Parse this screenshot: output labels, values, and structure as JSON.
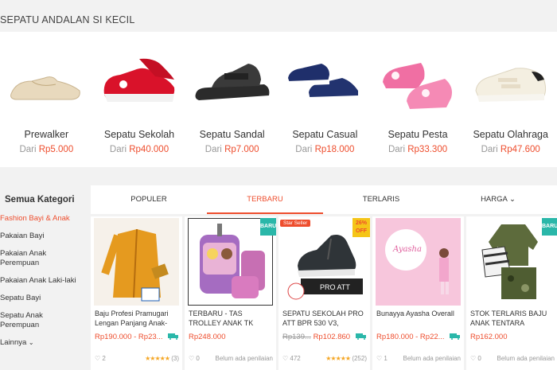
{
  "section": {
    "title": "SEPATU ANDALAN SI KECIL"
  },
  "categories": [
    {
      "name": "Prewalker",
      "price_prefix": "Dari",
      "price": "Rp5.000"
    },
    {
      "name": "Sepatu Sekolah",
      "price_prefix": "Dari",
      "price": "Rp40.000"
    },
    {
      "name": "Sepatu Sandal",
      "price_prefix": "Dari",
      "price": "Rp7.000"
    },
    {
      "name": "Sepatu Casual",
      "price_prefix": "Dari",
      "price": "Rp18.000"
    },
    {
      "name": "Sepatu Pesta",
      "price_prefix": "Dari",
      "price": "Rp33.300"
    },
    {
      "name": "Sepatu Olahraga",
      "price_prefix": "Dari",
      "price": "Rp47.600"
    }
  ],
  "sidebar": {
    "heading": "Semua Kategori",
    "items": [
      {
        "label": "Fashion Bayi & Anak"
      },
      {
        "label": "Pakaian Bayi"
      },
      {
        "label": "Pakaian Anak Perempuan"
      },
      {
        "label": "Pakaian Anak Laki-laki"
      },
      {
        "label": "Sepatu Bayi"
      },
      {
        "label": "Sepatu Anak Perempuan"
      },
      {
        "label": "Lainnya"
      }
    ]
  },
  "tabs": [
    {
      "label": "POPULER"
    },
    {
      "label": "TERBARU"
    },
    {
      "label": "TERLARIS"
    },
    {
      "label": "HARGA"
    }
  ],
  "products": [
    {
      "title": "Baju Profesi Pramugari Lengan Panjang Anak-",
      "price": "Rp190.000 - Rp23...",
      "likes": "2",
      "rating_text": "(3)"
    },
    {
      "title": "TERBARU - TAS TROLLEY ANAK TK",
      "price": "Rp248.000",
      "likes": "0",
      "rating_text": "Belum ada penilaian",
      "badge": "BARU"
    },
    {
      "title": "SEPATU SEKOLAH PRO ATT BPR 530 V3,",
      "price_old": "Rp139...",
      "price": "Rp102.860",
      "likes": "472",
      "rating_text": "(252)",
      "seller": "Star Seller",
      "discount": "26%",
      "discount_label": "OFF"
    },
    {
      "title": "Bunayya Ayasha Overall",
      "price": "Rp180.000 - Rp22...",
      "likes": "1",
      "rating_text": "Belum ada penilaian"
    },
    {
      "title": "STOK TERLARIS BAJU ANAK TENTARA",
      "price": "Rp162.000",
      "likes": "0",
      "rating_text": "Belum ada penilaian",
      "badge": "BARU"
    }
  ],
  "colors": {
    "accent": "#ee4d2d",
    "badge_new": "#2ab7a9",
    "badge_off": "#f5c518"
  }
}
